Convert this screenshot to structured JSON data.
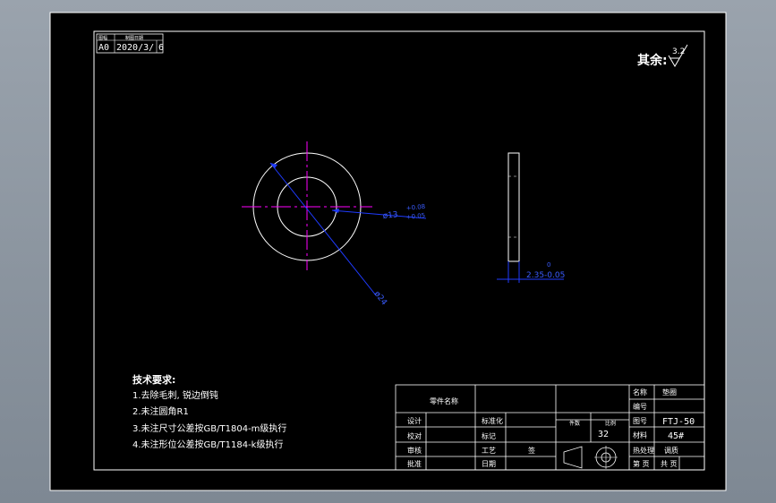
{
  "colors": {
    "background": "#8c96a0",
    "paper": "#000000",
    "line": "#ffffff",
    "centerline": "#ff00ff",
    "dimension": "#1f3bff"
  },
  "header_box": {
    "label_a": "图幅",
    "label_b": "制图日期",
    "sheet_size": "A0",
    "date": "2020/3/",
    "page": "6"
  },
  "roughness": {
    "label": "其余:",
    "value": "3.2"
  },
  "dimensions": {
    "inner_diameter": "ø13",
    "inner_tol_upper": "+0.08",
    "inner_tol_lower": "+0.05",
    "outer_diameter": "ø24",
    "thickness": "2.35-0.05",
    "thickness_upper": "0"
  },
  "tech_notes": {
    "title": "技术要求:",
    "items": [
      "1.去除毛刺, 锐边倒钝",
      "2.未注圆角R1",
      "3.未注尺寸公差按GB/T1804-m级执行",
      "4.未注形位公差按GB/T1184-k级执行"
    ]
  },
  "title_block": {
    "part_label": "零件名称",
    "designer": "设计",
    "checker": "校对",
    "reviewer": "审核",
    "approver": "批准",
    "standardize": "标准化",
    "mark": "标记",
    "process": "工艺",
    "date_label": "日期",
    "sign_mark": "签",
    "qty_label": "件数",
    "scale_label": "比例",
    "scale_value": "32",
    "name_label": "名称",
    "name_value": "垫圈",
    "code_label": "编号",
    "drawing_label": "图号",
    "drawing_no": "FTJ-50",
    "material_label": "材料",
    "material": "45#",
    "treatment_label": "热处理",
    "treatment": "调质",
    "sheet_label": "第 页",
    "total_label": "共 页"
  }
}
